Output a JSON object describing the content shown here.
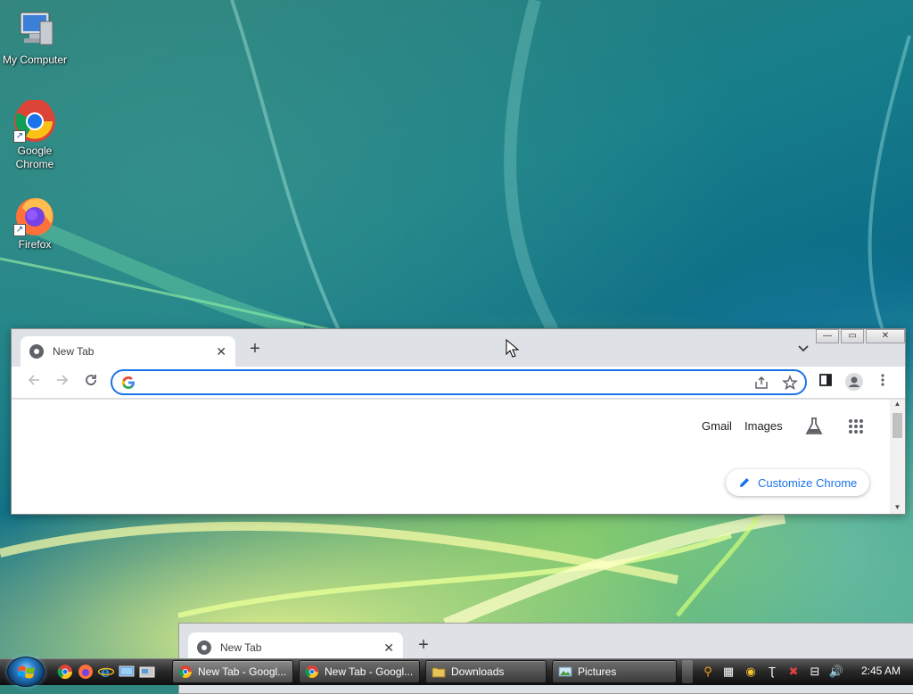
{
  "desktop": {
    "icons": [
      {
        "label": "My Computer"
      },
      {
        "label": "Google\nChrome"
      },
      {
        "label": "Firefox"
      }
    ]
  },
  "browser": {
    "tab_title": "New Tab",
    "tab_close": "✕",
    "new_tab": "+",
    "omnibox": {
      "value": "",
      "placeholder": ""
    },
    "links": {
      "gmail": "Gmail",
      "images": "Images"
    },
    "customize_label": "Customize Chrome",
    "caption": {
      "minimize": "—",
      "maximize": "▭",
      "close": "✕"
    }
  },
  "background_window": {
    "tab_title": "New Tab",
    "tab_close": "✕",
    "new_tab": "+"
  },
  "taskbar": {
    "tasks": [
      {
        "label": "New Tab - Googl...",
        "icon": "chrome-icon"
      },
      {
        "label": "New Tab - Googl...",
        "icon": "chrome-icon"
      },
      {
        "label": "Downloads",
        "icon": "folder-icon"
      },
      {
        "label": "Pictures",
        "icon": "pictures-icon"
      }
    ],
    "clock": "2:45 AM"
  },
  "colors": {
    "accent": "#1a73e8",
    "tab_bg": "#dee1e6"
  }
}
